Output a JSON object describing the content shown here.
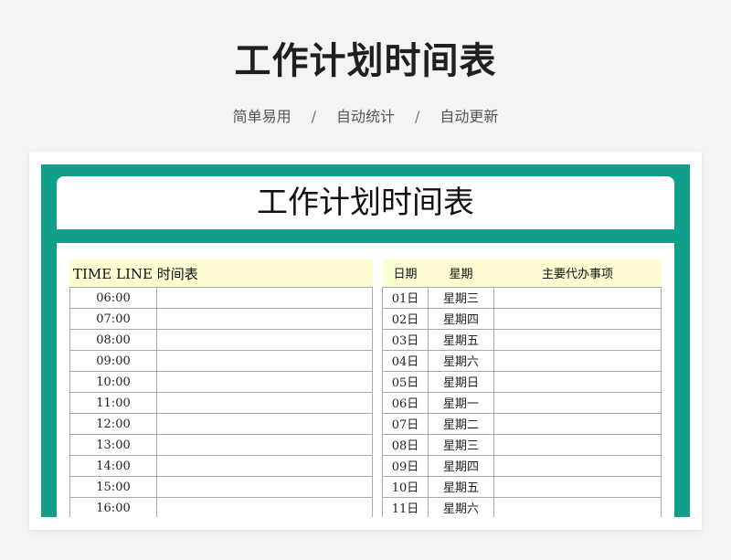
{
  "page": {
    "title": "工作计划时间表",
    "tags": [
      "简单易用",
      "自动统计",
      "自动更新"
    ],
    "separator": "/"
  },
  "sheet": {
    "title": "工作计划时间表",
    "theme_color": "#10a08a",
    "header_fill": "#fdfcd2"
  },
  "timeline": {
    "header": "TIME LINE 时间表",
    "times": [
      "06:00",
      "07:00",
      "08:00",
      "09:00",
      "10:00",
      "11:00",
      "12:00",
      "13:00",
      "14:00",
      "15:00",
      "16:00"
    ]
  },
  "calendar": {
    "headers": {
      "date": "日期",
      "weekday": "星期",
      "tasks": "主要代办事项"
    },
    "rows": [
      {
        "date": "01日",
        "weekday": "星期三"
      },
      {
        "date": "02日",
        "weekday": "星期四"
      },
      {
        "date": "03日",
        "weekday": "星期五"
      },
      {
        "date": "04日",
        "weekday": "星期六"
      },
      {
        "date": "05日",
        "weekday": "星期日"
      },
      {
        "date": "06日",
        "weekday": "星期一"
      },
      {
        "date": "07日",
        "weekday": "星期二"
      },
      {
        "date": "08日",
        "weekday": "星期三"
      },
      {
        "date": "09日",
        "weekday": "星期四"
      },
      {
        "date": "10日",
        "weekday": "星期五"
      },
      {
        "date": "11日",
        "weekday": "星期六"
      }
    ]
  }
}
